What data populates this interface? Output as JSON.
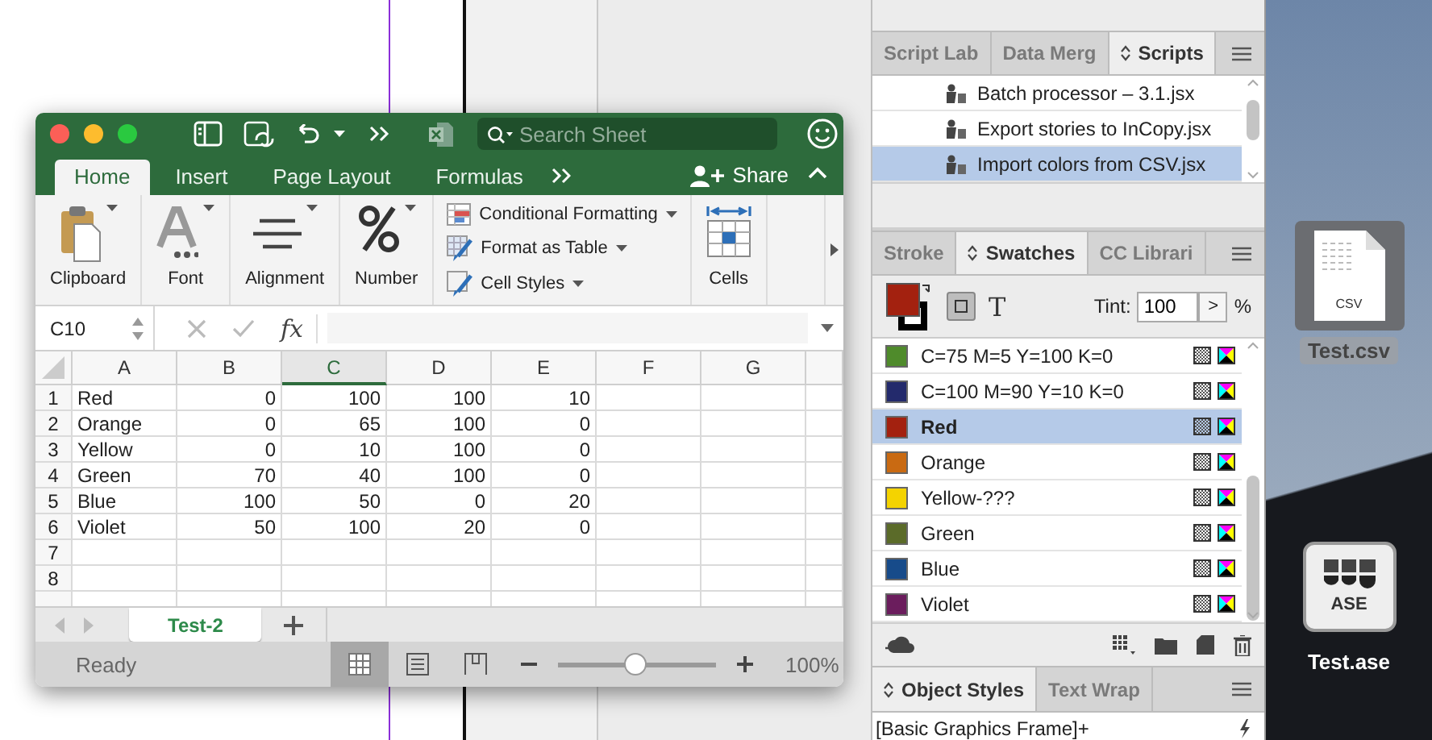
{
  "excel": {
    "search": {
      "placeholder": "Search Sheet"
    },
    "tabs": [
      {
        "label": "Home",
        "selected": true
      },
      {
        "label": "Insert",
        "selected": false
      },
      {
        "label": "Page Layout",
        "selected": false
      },
      {
        "label": "Formulas",
        "selected": false
      }
    ],
    "share": "Share",
    "ribbon_groups": [
      {
        "kind": "clipboard",
        "label": "Clipboard"
      },
      {
        "kind": "font",
        "label": "Font"
      },
      {
        "kind": "alignment",
        "label": "Alignment"
      },
      {
        "kind": "number",
        "label": "Number"
      },
      {
        "kind": "styles",
        "commands": [
          "Conditional Formatting",
          "Format as Table",
          "Cell Styles"
        ]
      },
      {
        "kind": "cells",
        "label": "Cells"
      }
    ],
    "name_box": "C10",
    "function_label": "fx",
    "columns": [
      {
        "label": "A",
        "selected": false
      },
      {
        "label": "B",
        "selected": false
      },
      {
        "label": "C",
        "selected": true
      },
      {
        "label": "D",
        "selected": false
      },
      {
        "label": "E",
        "selected": false
      },
      {
        "label": "F",
        "selected": false
      },
      {
        "label": "G",
        "selected": false
      }
    ],
    "rows": [
      {
        "number": "1",
        "cells": [
          "Red",
          "0",
          "100",
          "100",
          "10"
        ]
      },
      {
        "number": "2",
        "cells": [
          "Orange",
          "0",
          "65",
          "100",
          "0"
        ]
      },
      {
        "number": "3",
        "cells": [
          "Yellow",
          "0",
          "10",
          "100",
          "0"
        ]
      },
      {
        "number": "4",
        "cells": [
          "Green",
          "70",
          "40",
          "100",
          "0"
        ]
      },
      {
        "number": "5",
        "cells": [
          "Blue",
          "100",
          "50",
          "0",
          "20"
        ]
      },
      {
        "number": "6",
        "cells": [
          "Violet",
          "50",
          "100",
          "20",
          "0"
        ]
      },
      {
        "number": "7"
      },
      {
        "number": "8"
      }
    ],
    "sheet_tabs": [
      {
        "label": "Test-2",
        "selected": true
      }
    ],
    "status": "Ready",
    "views": [
      {
        "kind": "normal",
        "selected": true
      },
      {
        "kind": "page_layout",
        "selected": false
      },
      {
        "kind": "page_break",
        "selected": false
      }
    ],
    "zoom": {
      "level": 0.49,
      "reading": "100%"
    }
  },
  "scripts_panel": {
    "tabs": [
      {
        "label": "Script Lab",
        "selected": false
      },
      {
        "label": "Data Merg",
        "selected": false
      },
      {
        "label": "Scripts",
        "selected": true
      }
    ],
    "items": [
      {
        "label": "Batch processor – 3.1.jsx",
        "selected": false
      },
      {
        "label": "Export stories to InCopy.jsx",
        "selected": false
      },
      {
        "label": "Import colors from CSV.jsx",
        "selected": true
      }
    ]
  },
  "swatches_panel": {
    "tabs": [
      {
        "label": "Stroke",
        "selected": false
      },
      {
        "label": "Swatches",
        "selected": true
      },
      {
        "label": "CC Librari",
        "selected": false
      }
    ],
    "text_button": "T",
    "tint": {
      "label": "Tint:",
      "value": "100",
      "step": ">",
      "unit": "%"
    },
    "items": [
      {
        "name": "C=75 M=5 Y=100 K=0",
        "color": "#4f8b2b",
        "selected": false
      },
      {
        "name": "C=100 M=90 Y=10 K=0",
        "color": "#232a6c",
        "selected": false
      },
      {
        "name": "Red",
        "color": "#a3210f",
        "selected": true
      },
      {
        "name": "Orange",
        "color": "#c96a12",
        "selected": false
      },
      {
        "name": "Yellow-???",
        "color": "#f4d300",
        "selected": false
      },
      {
        "name": "Green",
        "color": "#5b6b29",
        "selected": false
      },
      {
        "name": "Blue",
        "color": "#174b8a",
        "selected": false
      },
      {
        "name": "Violet",
        "color": "#6b1d5d",
        "selected": false
      }
    ]
  },
  "object_styles_panel": {
    "tabs": [
      {
        "label": "Object Styles",
        "selected": true
      },
      {
        "label": "Text Wrap",
        "selected": false
      }
    ],
    "current": "[Basic Graphics Frame]+"
  },
  "desktop": {
    "files": [
      {
        "kind": "csv",
        "badge": "CSV",
        "name": "Test.csv",
        "selected": true
      },
      {
        "kind": "ase",
        "badge": "ASE",
        "name": "Test.ase",
        "selected": false
      }
    ]
  }
}
